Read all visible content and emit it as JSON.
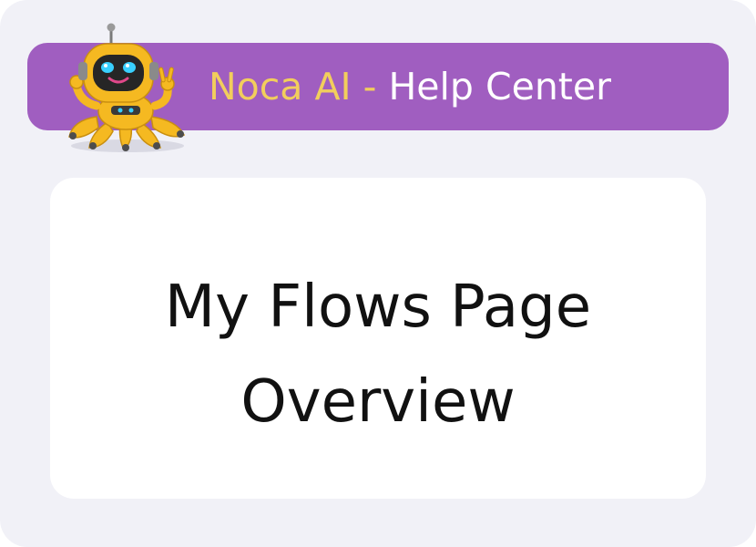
{
  "header": {
    "brand": "Noca AI",
    "separator": " - ",
    "section": "Help Center"
  },
  "main": {
    "title_line1": "My Flows Page",
    "title_line2": "Overview"
  },
  "colors": {
    "banner": "#a05ec0",
    "brand_text": "#f2ce5c",
    "background": "#f1f1f7",
    "card": "#ffffff",
    "mascot_body": "#f5b921"
  },
  "icons": {
    "mascot": "robot-mascot-icon"
  }
}
